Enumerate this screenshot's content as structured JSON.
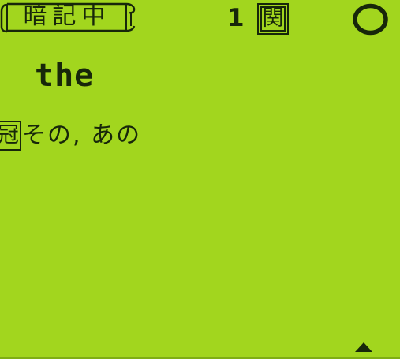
{
  "header": {
    "mode_label": "暗記中",
    "count": "1",
    "related_badge": "関",
    "result_icon": "circle-icon"
  },
  "entry": {
    "headword": "the",
    "definitions": [
      {
        "pos_badge": "冠",
        "text": "その, あの"
      }
    ]
  },
  "footer": {
    "scroll_icon": "scroll-up-arrow-icon"
  },
  "colors": {
    "lcd_background": "#a2d61e",
    "lcd_ink": "#17270a"
  }
}
